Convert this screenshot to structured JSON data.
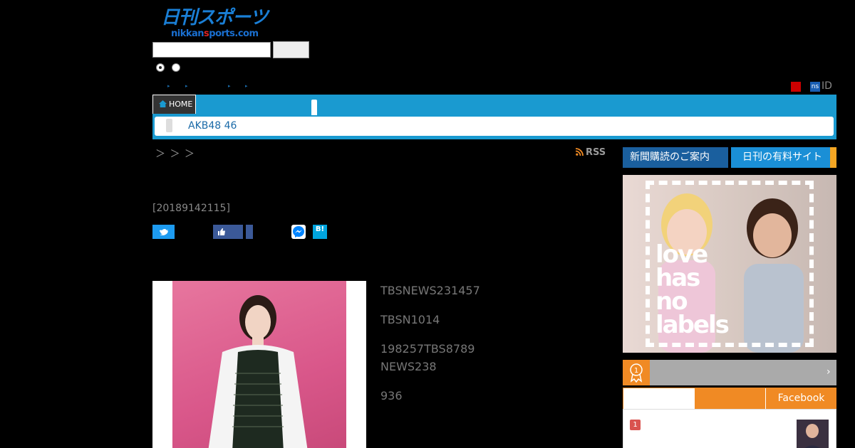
{
  "header": {
    "logo_text": "日刊スポーツ",
    "logo_domain_prefix": "nikkan",
    "logo_domain_highlight": "s",
    "logo_domain_suffix": "ports.com"
  },
  "account": {
    "ns_badge": "ns",
    "id_label": "ID"
  },
  "nav": {
    "home_label": "HOME",
    "topic_text": "AKB48   46"
  },
  "breadcrumb": "＞ ＞ ＞",
  "rss_label": "RSS",
  "article": {
    "date": "[20189142115]",
    "paragraphs": [
      "TBSNEWS231457",
      "TBSN1014",
      "198257TBS8789",
      "NEWS238",
      "936"
    ]
  },
  "sidebar": {
    "subscribe_label": "新聞購読のご案内",
    "paid_site_label": "日刊の有料サイト",
    "ad_text_lines": [
      "love",
      "has",
      "no",
      "labels"
    ],
    "ranking_badge_num": "1",
    "ranking_chevron": "›",
    "facebook_tab": "Facebook",
    "rank_item_num": "1"
  },
  "colors": {
    "nav_blue": "#1a9ad0",
    "accent_orange": "#f08a24"
  }
}
